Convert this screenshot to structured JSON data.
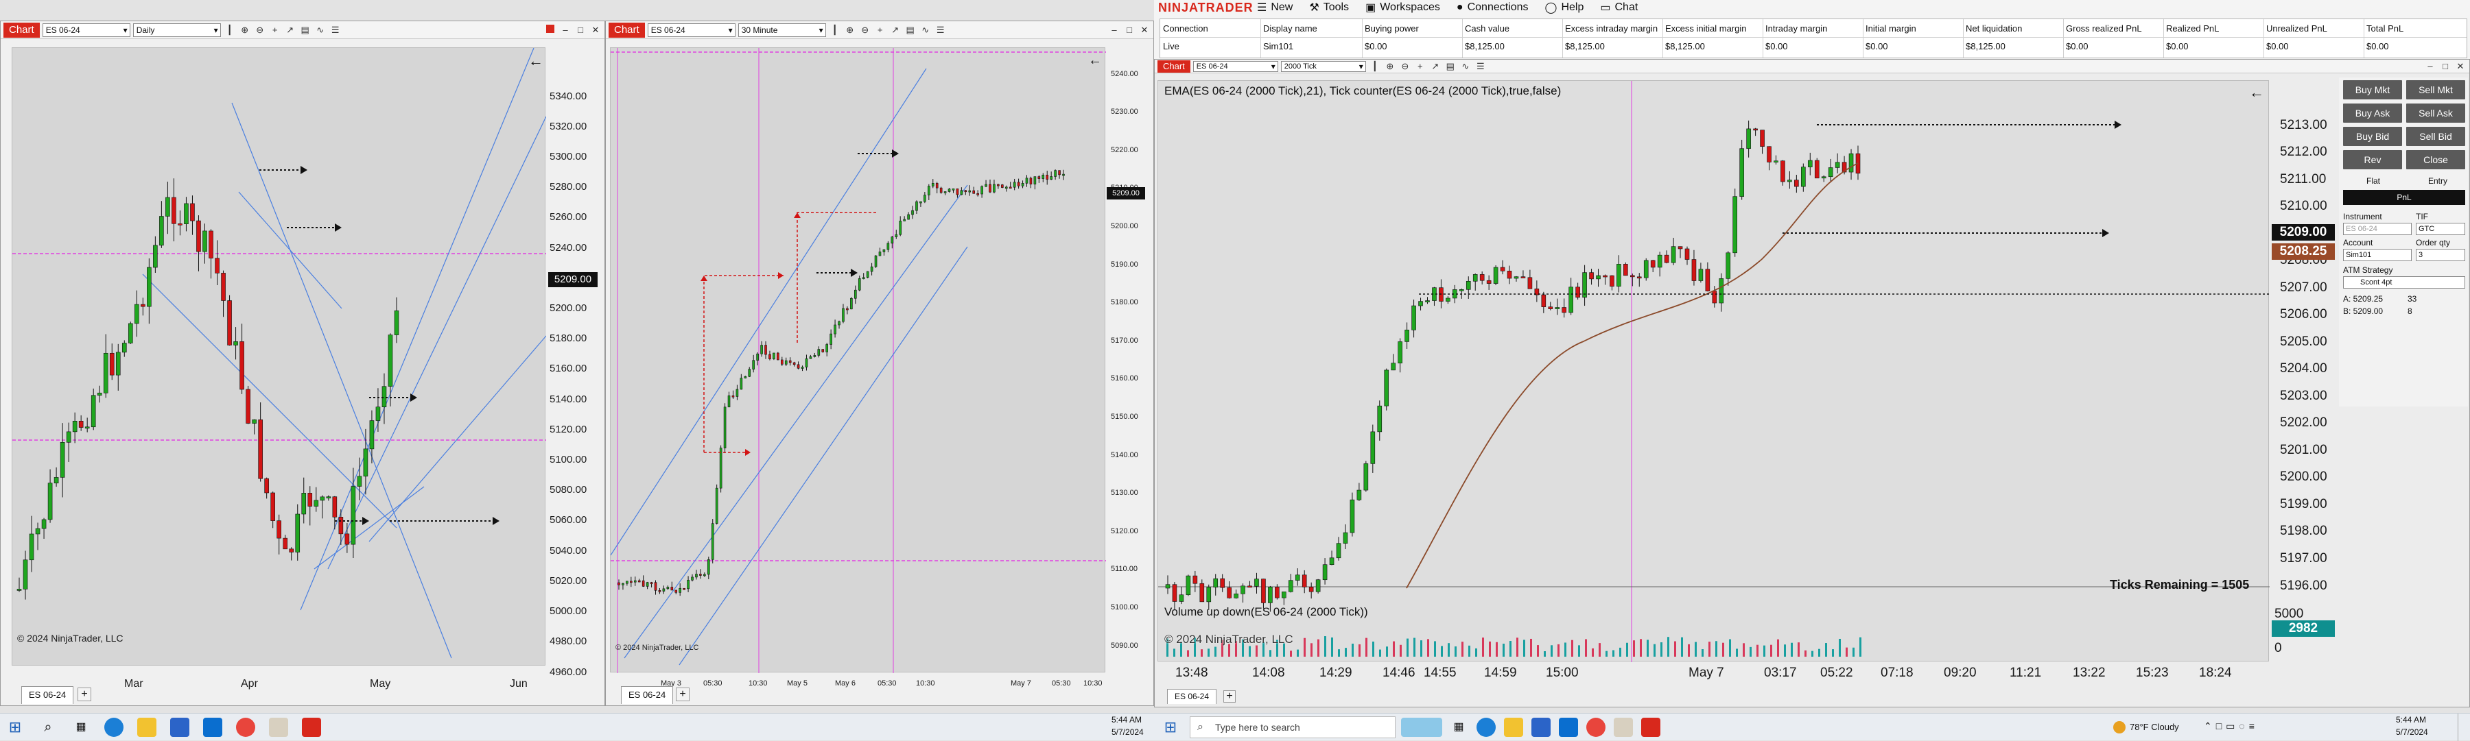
{
  "left_window": {
    "chart_tag": "Chart",
    "instrument": "ES 06-24",
    "period": "Daily",
    "price_labels": [
      "5340.00",
      "5320.00",
      "5300.00",
      "5280.00",
      "5260.00",
      "5240.00",
      "5220.00",
      "5200.00",
      "5180.00",
      "5160.00",
      "5140.00",
      "5120.00",
      "5100.00",
      "5080.00",
      "5060.00",
      "5040.00",
      "5020.00",
      "5000.00",
      "4980.00",
      "4960.00"
    ],
    "current_price": "5209.00",
    "time_labels": [
      "Mar",
      "Apr",
      "May",
      "Jun"
    ],
    "copyright": "© 2024 NinjaTrader, LLC",
    "tab_label": "ES 06-24"
  },
  "mid_window": {
    "chart_tag": "Chart",
    "instrument": "ES 06-24",
    "period": "30 Minute",
    "price_labels": [
      "5240.00",
      "5230.00",
      "5220.00",
      "5210.00",
      "5200.00",
      "5190.00",
      "5180.00",
      "5170.00",
      "5160.00",
      "5150.00",
      "5140.00",
      "5130.00",
      "5120.00",
      "5110.00",
      "5100.00",
      "5090.00"
    ],
    "current_price": "5209.00",
    "time_labels": [
      "May 3",
      "05:30",
      "10:30",
      "May 5",
      "May 6",
      "05:30",
      "10:30",
      "May 7",
      "05:30",
      "10:30"
    ],
    "copyright": "© 2024 NinjaTrader, LLC",
    "tab_label": "ES 06-24"
  },
  "control_center": {
    "logo": "NINJATRADER",
    "menu": [
      "New",
      "Tools",
      "Workspaces",
      "Connections",
      "Help",
      "Chat"
    ],
    "columns": [
      "Connection",
      "Display name",
      "Buying power",
      "Cash value",
      "Excess intraday margin",
      "Excess initial margin",
      "Intraday margin",
      "Initial margin",
      "Net liquidation",
      "Gross realized PnL",
      "Realized PnL",
      "Unrealized PnL",
      "Total PnL"
    ],
    "row": [
      "Live",
      "Sim101",
      "$0.00",
      "$8,125.00",
      "$8,125.00",
      "$8,125.00",
      "$0.00",
      "$0.00",
      "$8,125.00",
      "$0.00",
      "$0.00",
      "$0.00",
      "$0.00"
    ]
  },
  "right_chart": {
    "chart_tag": "Chart",
    "instrument": "ES 06-24",
    "period": "2000 Tick",
    "indicator_title": "EMA(ES 06-24 (2000 Tick),21), Tick counter(ES 06-24 (2000 Tick),true,false)",
    "price_labels": [
      "5213.00",
      "5212.00",
      "5211.00",
      "5210.00",
      "5209.00",
      "5208.00",
      "5207.00",
      "5206.00",
      "5205.00",
      "5204.00",
      "5203.00",
      "5202.00",
      "5201.00",
      "5200.00",
      "5199.00",
      "5198.00",
      "5197.00",
      "5196.00"
    ],
    "current_price": "5209.00",
    "ema_price": "5208.25",
    "ticks_remaining": "Ticks Remaining = 1505",
    "volume_title": "Volume up down(ES 06-24 (2000 Tick))",
    "volume_value": "2982",
    "volume_axis": [
      "5000",
      "0"
    ],
    "copyright": "© 2024 NinjaTrader, LLC",
    "time_labels": [
      "13:48",
      "14:08",
      "14:29",
      "14:46",
      "14:55",
      "14:59",
      "15:00",
      "May 7",
      "03:17",
      "05:22",
      "07:18",
      "09:20",
      "11:21",
      "13:22",
      "15:23",
      "18:24"
    ],
    "tab_label": "ES 06-24"
  },
  "chart_trader": {
    "buttons": [
      "Buy Mkt",
      "Sell Mkt",
      "Buy Ask",
      "Sell Ask",
      "Buy Bid",
      "Sell Bid",
      "Rev",
      "Close"
    ],
    "flat": "Flat",
    "entry": "Entry",
    "pnl": "PnL",
    "instrument_label": "Instrument",
    "instrument_value": "ES 06-24",
    "tif_label": "TIF",
    "tif_value": "GTC",
    "account_label": "Account",
    "account_value": "Sim101",
    "qty_label": "Order qty",
    "qty_value": "3",
    "atm_label": "ATM Strategy",
    "atm_value": "Scont 4pt",
    "ask_row": "A: 5209.25",
    "ask_size": "33",
    "bid_row": "B: 5209.00",
    "bid_size": "8"
  },
  "taskbar_left": {
    "time": "5:44 AM",
    "date": "5/7/2024"
  },
  "taskbar_right": {
    "search_placeholder": "Type here to search",
    "weather": "78°F  Cloudy",
    "time": "5:44 AM",
    "date": "5/7/2024"
  },
  "colors": {
    "up": "#1fa61f",
    "down": "#d21414",
    "level": "#e040e0",
    "trend": "#4a7fe0",
    "ema": "#8b4a2a",
    "accent": "#d8281c"
  }
}
